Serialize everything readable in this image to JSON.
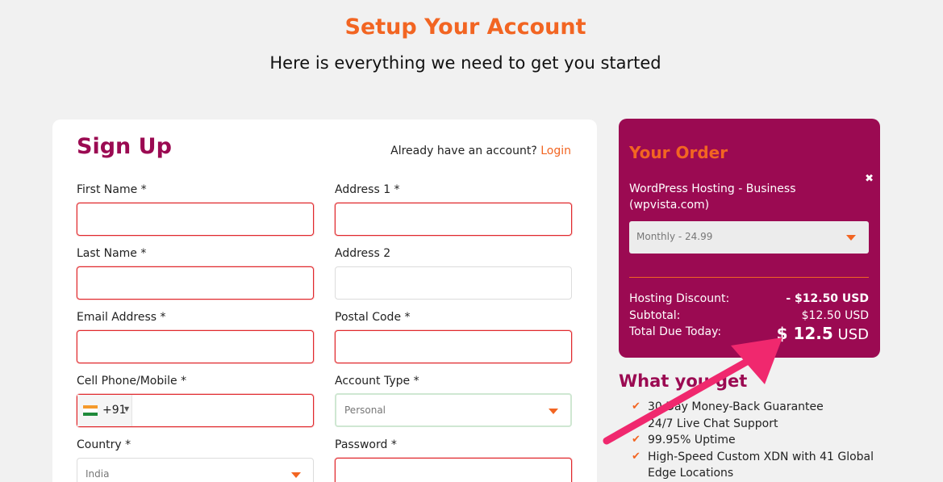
{
  "header": {
    "title": "Setup Your Account",
    "subtitle": "Here is everything we need to get you started"
  },
  "signup": {
    "title": "Sign Up",
    "already_text": "Already have an account?",
    "login_link": "Login",
    "fields": {
      "first_name": {
        "label": "First Name *",
        "value": ""
      },
      "address1": {
        "label": "Address 1 *",
        "value": ""
      },
      "last_name": {
        "label": "Last Name *",
        "value": ""
      },
      "address2": {
        "label": "Address 2",
        "value": ""
      },
      "email": {
        "label": "Email Address *",
        "value": ""
      },
      "postal_code": {
        "label": "Postal Code *",
        "value": ""
      },
      "phone": {
        "label": "Cell Phone/Mobile *",
        "country_code": "+91",
        "value": ""
      },
      "account_type": {
        "label": "Account Type *",
        "value": "Personal"
      },
      "country": {
        "label": "Country *",
        "value": "India"
      },
      "password": {
        "label": "Password *",
        "value": ""
      }
    }
  },
  "order": {
    "title": "Your Order",
    "close_icon": "✖",
    "product": "WordPress Hosting - Business (wpvista.com)",
    "billing_cycle": "Monthly - 24.99",
    "discount_label": "Hosting Discount:",
    "discount_value": "- $12.50 USD",
    "subtotal_label": "Subtotal:",
    "subtotal_value": "$12.50 USD",
    "total_label": "Total Due Today:",
    "total_amount": "$ 12.5",
    "total_currency": "USD"
  },
  "what_you_get": {
    "title": "What you get",
    "items": [
      "30 Day Money-Back Guarantee",
      "24/7 Live Chat Support",
      "99.95% Uptime",
      "High-Speed Custom XDN with 41 Global Edge Locations"
    ]
  },
  "colors": {
    "accent": "#f26522",
    "brand": "#9b0a52",
    "annotation_arrow": "#f0286e"
  }
}
